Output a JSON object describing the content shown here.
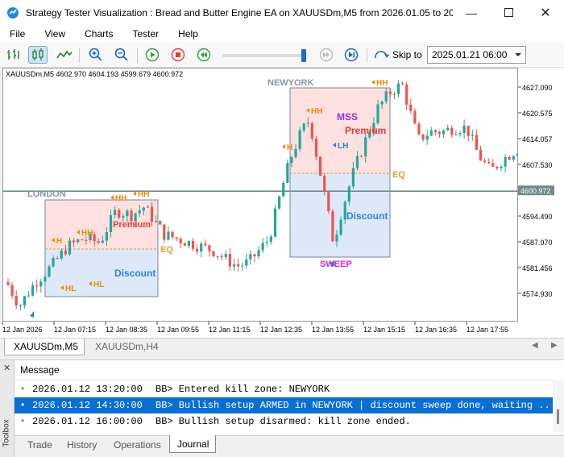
{
  "window": {
    "title": "Strategy Tester Visualization : Bread and Butter Engine EA on XAUUSDm,M5 from 2026.01.05 to 20..."
  },
  "menu": [
    "File",
    "View",
    "Charts",
    "Tester",
    "Help"
  ],
  "toolbar": {
    "skip_label": "Skip to",
    "skip_value": "2025.01.21 06:00"
  },
  "chart": {
    "symbol_info": "XAUUSDm,M5  4602.970 4604.193 4599.679 4600.972",
    "price_ticks": [
      "4627.090",
      "4620.575",
      "4614.057",
      "4607.530",
      "4594.490",
      "4587.970",
      "4581.456",
      "4574.930"
    ],
    "current_price": "4600.972",
    "time_ticks": [
      "12 Jan 2026",
      "12 Jan 07:15",
      "12 Jan 08:35",
      "12 Jan 09:55",
      "12 Jan 11:15",
      "12 Jan 12:35",
      "12 Jan 13:55",
      "12 Jan 15:15",
      "12 Jan 16:35",
      "12 Jan 17:55"
    ],
    "london": {
      "label": "LONDON",
      "premium": "Premium",
      "discount": "Discount",
      "eq": "EQ"
    },
    "newyork": {
      "label": "NEWYORK",
      "premium": "Premium",
      "discount": "Discount",
      "eq": "EQ",
      "mss": "MSS",
      "sweep": "SWEEP"
    },
    "swing_labels": {
      "h": "H",
      "hh": "HH",
      "hl": "HL",
      "lh": "LH"
    },
    "colors": {
      "bull": "#26a69a",
      "bear": "#ef5350",
      "premium_fill": "#fde0e0",
      "discount_fill": "#dde9f8",
      "label_orange": "#f08a00",
      "mss": "#9b30d9",
      "sweep": "#e020d0"
    }
  },
  "tabs": {
    "active": "XAUUSDm,M5",
    "other": "XAUUSDm,H4"
  },
  "toolbox": {
    "header": "Message",
    "side_label": "Toolbox",
    "messages": [
      {
        "time": "2026.01.12 13:20:00",
        "text": "BB> Entered kill zone: NEWYORK",
        "selected": false
      },
      {
        "time": "2026.01.12 14:30:00",
        "text": "BB> Bullish setup ARMED in NEWYORK | discount sweep done, waiting ...",
        "selected": true
      },
      {
        "time": "2026.01.12 16:00:00",
        "text": "BB> Bullish setup disarmed: kill zone ended.",
        "selected": false
      }
    ],
    "tabs": [
      "Trade",
      "History",
      "Operations",
      "Journal"
    ],
    "active_tab": "Journal"
  }
}
